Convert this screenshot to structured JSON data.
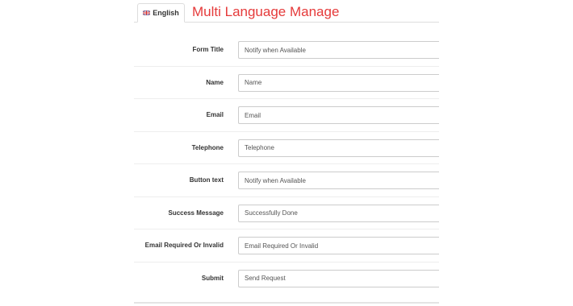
{
  "tabs": [
    {
      "label": "English",
      "flag": "uk-flag-icon",
      "active": true
    }
  ],
  "page_title": "Multi Language Manage",
  "colors": {
    "title": "#e53a3a",
    "label": "#333333",
    "input_border": "#cccccc"
  },
  "fields": [
    {
      "label": "Form Title",
      "value": "Notify when Available"
    },
    {
      "label": "Name",
      "value": "Name"
    },
    {
      "label": "Email",
      "value": "Email"
    },
    {
      "label": "Telephone",
      "value": "Telephone"
    },
    {
      "label": "Button text",
      "value": "Notify when Available"
    },
    {
      "label": "Success Message",
      "value": "Successfully Done"
    },
    {
      "label": "Email Required Or Invalid",
      "value": "Email Required Or Invalid"
    },
    {
      "label": "Submit",
      "value": "Send Request"
    }
  ]
}
